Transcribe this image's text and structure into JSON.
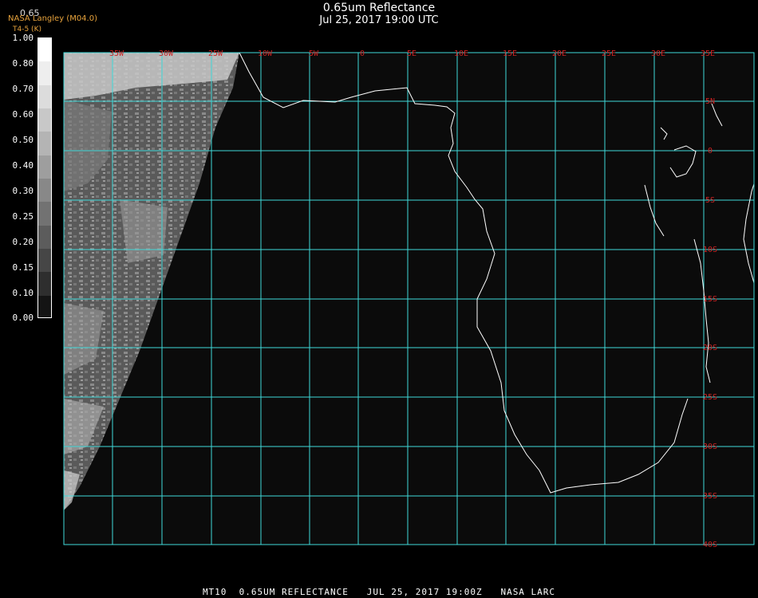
{
  "header": {
    "title": "0.65um Reflectance",
    "subtitle": "Jul 25, 2017 19:00 UTC",
    "producer": "NASA Langley (M04.0)",
    "sub_label": "T4-5 (K)",
    "top_value": "0.65"
  },
  "colorbar": {
    "labels": [
      "1.00",
      "0.80",
      "0.70",
      "0.60",
      "0.50",
      "0.40",
      "0.30",
      "0.25",
      "0.20",
      "0.15",
      "0.10",
      "0.00"
    ],
    "shades": [
      "#ffffff",
      "#eeeeee",
      "#dcdcdc",
      "#c8c8c8",
      "#b4b4b4",
      "#9e9e9e",
      "#888888",
      "#727272",
      "#5c5c5c",
      "#464646",
      "#2e2e2e",
      "#141414"
    ]
  },
  "map": {
    "lon_labels": [
      "35W",
      "30W",
      "25W",
      "10W",
      "5W",
      "0",
      "5E",
      "10E",
      "15E",
      "20E",
      "25E",
      "30E",
      "35E"
    ],
    "lat_labels": [
      "5N",
      "0",
      "5S",
      "10S",
      "15S",
      "20S",
      "25S",
      "30S",
      "35S",
      "40S"
    ],
    "grid_color": "#3fd8d8",
    "coast_color": "#ffffff"
  },
  "footer": {
    "text": "MT10  0.65UM REFLECTANCE   JUL 25, 2017 19:00Z   NASA LARC"
  }
}
